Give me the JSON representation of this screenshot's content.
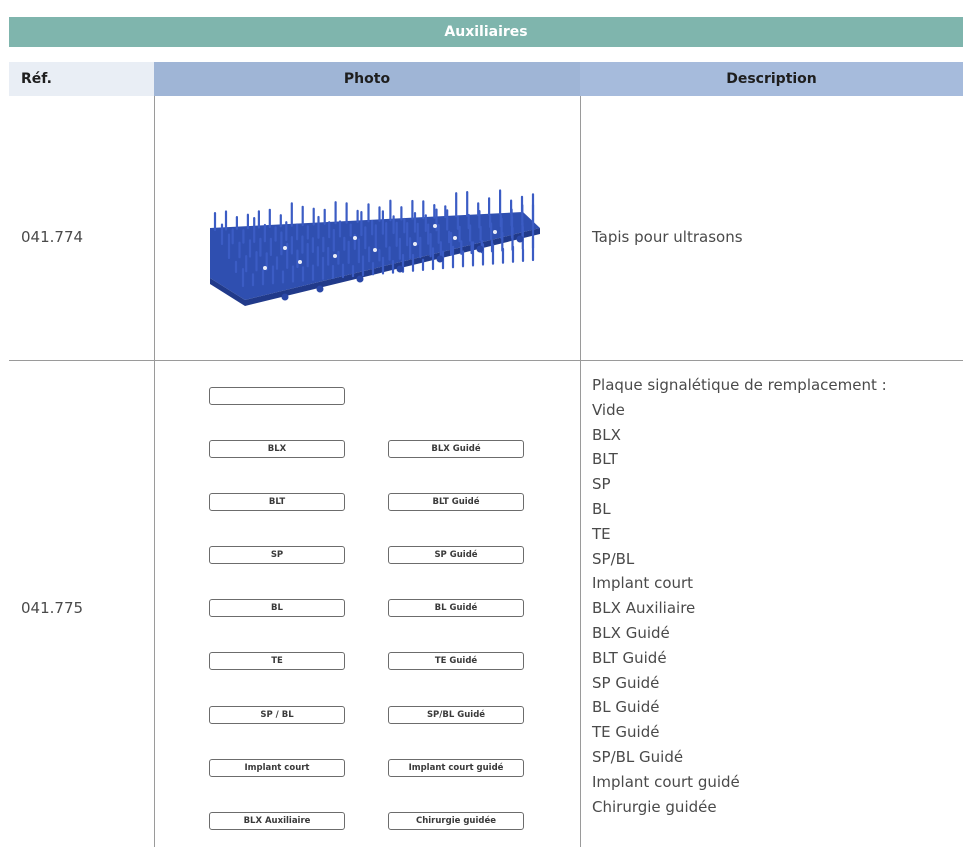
{
  "section_title": "Auxiliaires",
  "columns": {
    "ref": "Réf.",
    "photo": "Photo",
    "description": "Description"
  },
  "rows": [
    {
      "ref": "041.774",
      "description": "Tapis pour ultrasons"
    },
    {
      "ref": "041.775",
      "description_lines": [
        "Plaque signalétique de remplacement :",
        "Vide",
        "BLX",
        "BLT",
        "SP",
        "BL",
        "TE",
        "SP/BL",
        "Implant court",
        "BLX Auxiliaire",
        "BLX Guidé",
        "BLT Guidé",
        "SP Guidé",
        "BL Guidé",
        "TE Guidé",
        "SP/BL Guidé",
        "Implant court guidé",
        "Chirurgie guidée"
      ],
      "plates_left": [
        "",
        "BLX",
        "BLT",
        "SP",
        "BL",
        "TE",
        "SP / BL",
        "Implant court",
        "BLX Auxiliaire"
      ],
      "plates_right": [
        "BLX Guidé",
        "BLT Guidé",
        "SP Guidé",
        "BL Guidé",
        "TE Guidé",
        "SP/BL Guidé",
        "Implant court guidé",
        "Chirurgie guidée"
      ]
    }
  ],
  "colors": {
    "title_bg": "#7fb5ad",
    "photo_header_bg": "#9fb5d6",
    "desc_header_bg": "#a6bbdc",
    "mat_blue": "#2f4fb0"
  }
}
